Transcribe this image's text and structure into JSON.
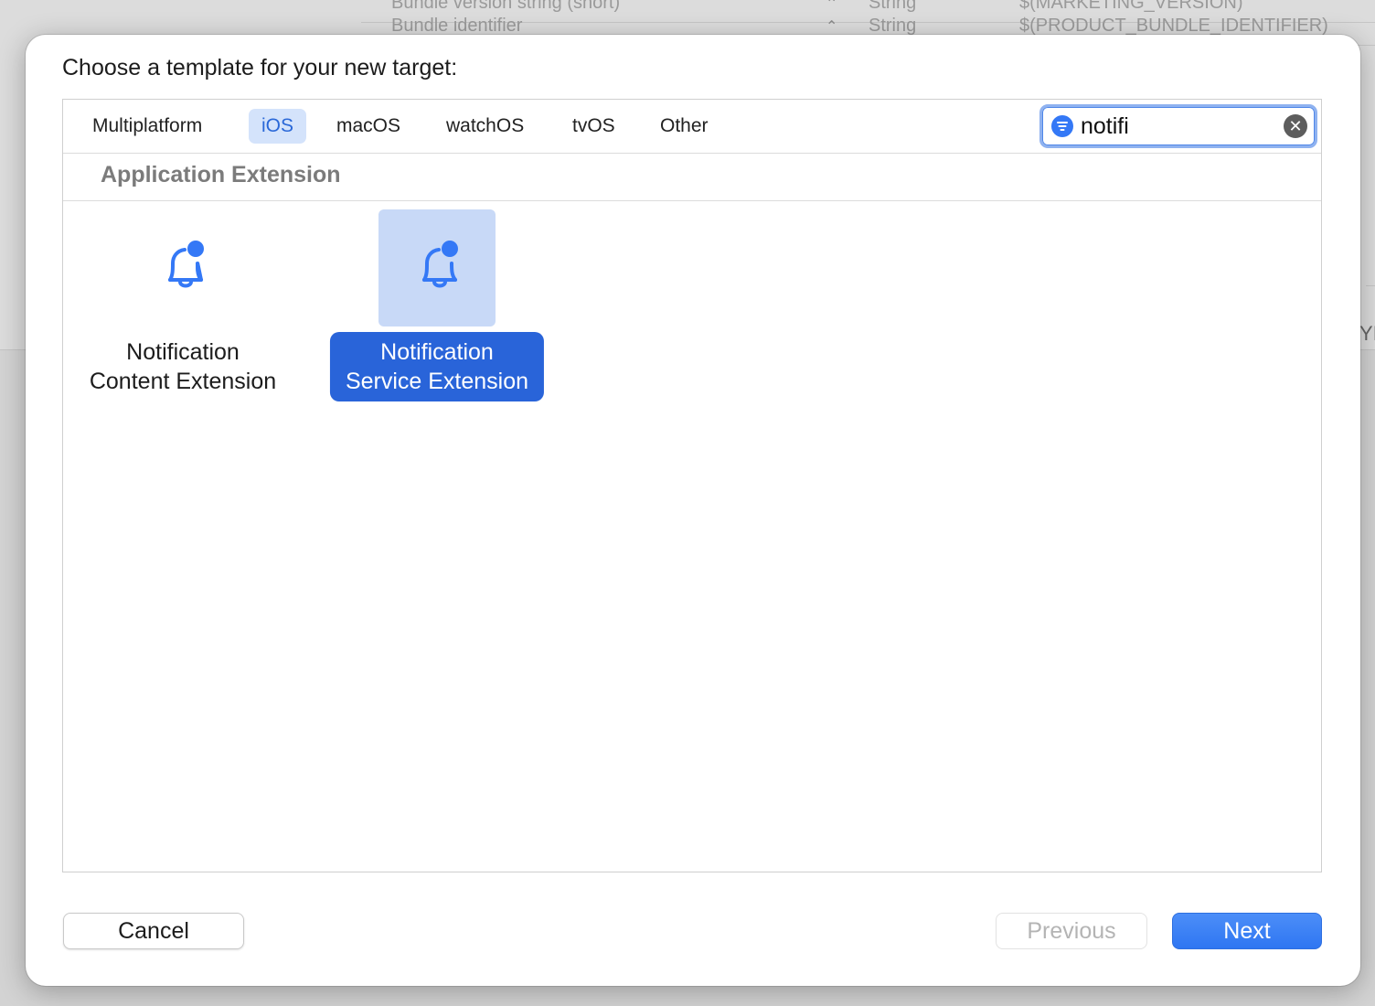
{
  "background": {
    "rows": [
      {
        "key": "Bundle version string (short)",
        "type": "String",
        "value": "$(MARKETING_VERSION)"
      },
      {
        "key": "Bundle identifier",
        "type": "String",
        "value": "$(PRODUCT_BUNDLE_IDENTIFIER)"
      }
    ],
    "side_fragment": "YI"
  },
  "dialog": {
    "title": "Choose a template for your new target:",
    "tabs": [
      "Multiplatform",
      "iOS",
      "macOS",
      "watchOS",
      "tvOS",
      "Other"
    ],
    "selected_tab": "iOS",
    "search": {
      "value": "notifi",
      "filter_icon": "filter-icon",
      "clear_icon": "clear-icon"
    },
    "section_title": "Application Extension",
    "templates": [
      {
        "line1": "Notification",
        "line2": "Content Extension",
        "icon": "bell-badge-icon",
        "selected": false
      },
      {
        "line1": "Notification",
        "line2": "Service Extension",
        "icon": "bell-badge-icon",
        "selected": true
      }
    ],
    "buttons": {
      "cancel": "Cancel",
      "previous": "Previous",
      "next": "Next"
    }
  },
  "colors": {
    "accent": "#2964d9",
    "icon_blue": "#3478f6",
    "selected_tab_bg": "#d4e3fb",
    "selected_icon_bg": "#c8d9f7"
  }
}
